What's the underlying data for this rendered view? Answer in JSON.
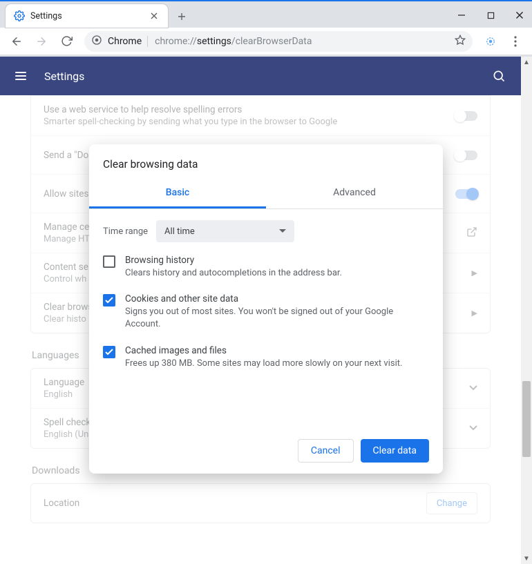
{
  "tab": {
    "title": "Settings"
  },
  "omnibox": {
    "scheme": "Chrome",
    "prefix": "chrome://",
    "high": "settings",
    "suffix": "/clearBrowserData"
  },
  "header": {
    "title": "Settings"
  },
  "rows": {
    "spell": {
      "title": "Use a web service to help resolve spelling errors",
      "sub": "Smarter spell-checking by sending what you type in the browser to Google"
    },
    "dnt": {
      "title": "Send a \"Do"
    },
    "allow_sites": {
      "title": "Allow sites"
    },
    "certs": {
      "title": "Manage ce",
      "sub": "Manage HT"
    },
    "content": {
      "title": "Content se",
      "sub": "Control wh"
    },
    "clear": {
      "title": "Clear brows",
      "sub": "Clear histo"
    }
  },
  "sections": {
    "languages": "Languages",
    "downloads": "Downloads"
  },
  "lang_rows": {
    "language": {
      "title": "Language",
      "sub": "English"
    },
    "spellcheck": {
      "title": "Spell check",
      "sub": "English (United States)"
    }
  },
  "download_rows": {
    "location": {
      "title": "Location",
      "change": "Change"
    }
  },
  "dialog": {
    "title": "Clear browsing data",
    "tabs": {
      "basic": "Basic",
      "advanced": "Advanced"
    },
    "time_label": "Time range",
    "time_value": "All time",
    "options": [
      {
        "title": "Browsing history",
        "sub": "Clears history and autocompletions in the address bar.",
        "checked": false
      },
      {
        "title": "Cookies and other site data",
        "sub": "Signs you out of most sites. You won't be signed out of your Google Account.",
        "checked": true
      },
      {
        "title": "Cached images and files",
        "sub": "Frees up 380 MB. Some sites may load more slowly on your next visit.",
        "checked": true
      }
    ],
    "buttons": {
      "cancel": "Cancel",
      "clear": "Clear data"
    }
  }
}
